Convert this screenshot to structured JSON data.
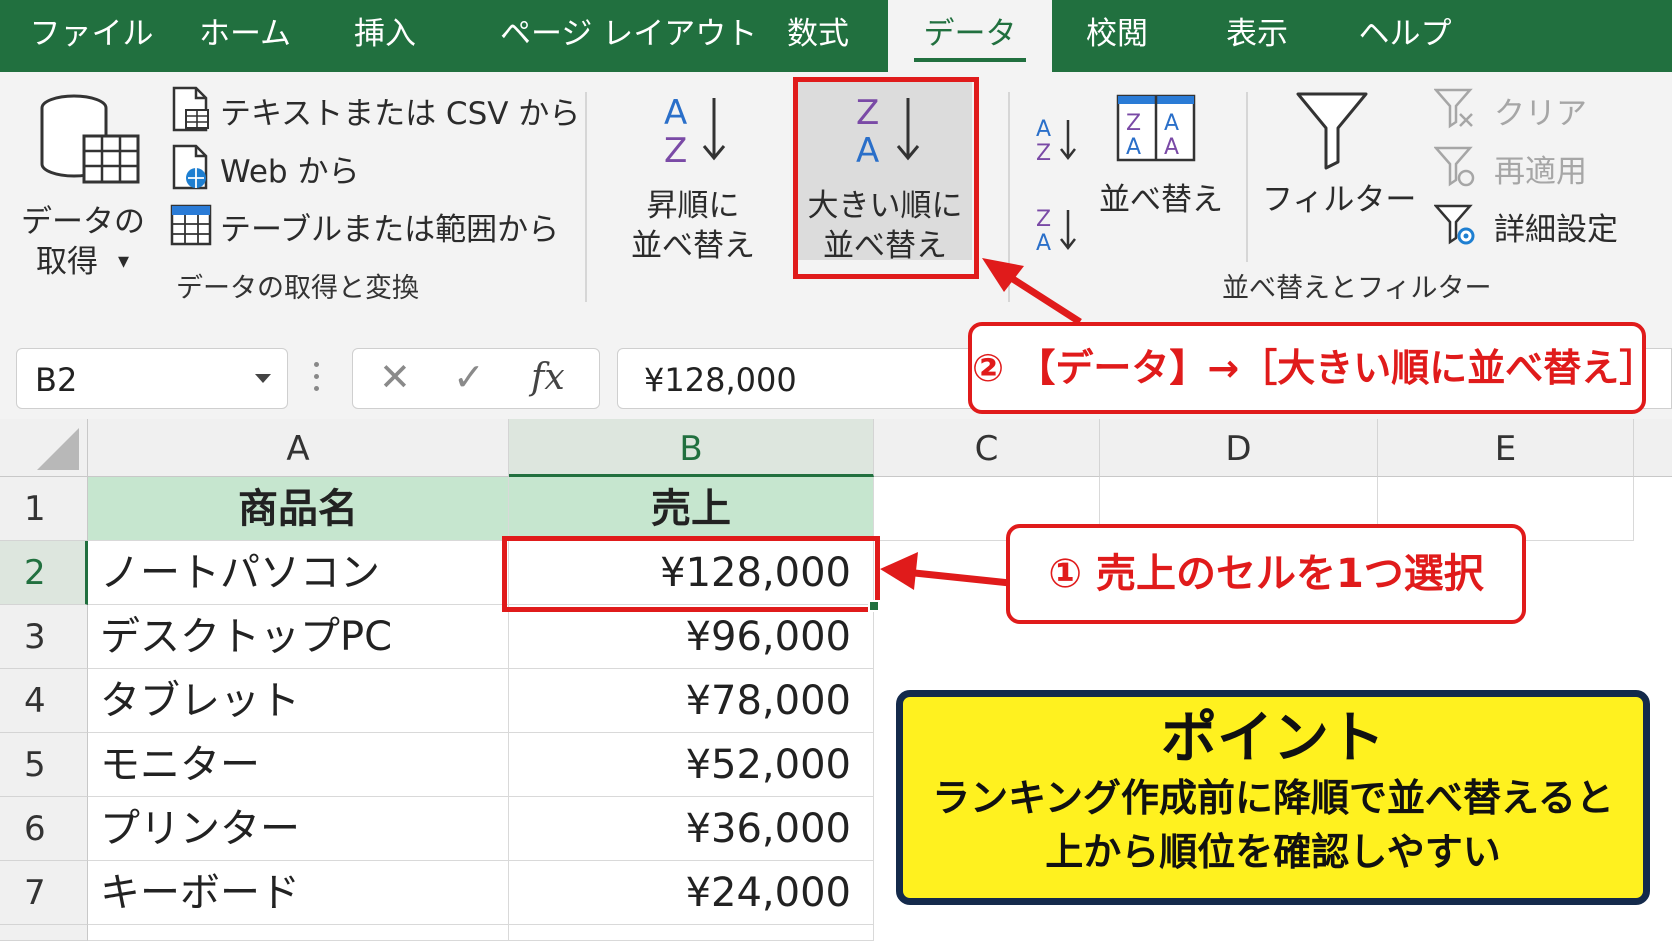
{
  "tabs": [
    {
      "label": "ファイル"
    },
    {
      "label": "ホーム"
    },
    {
      "label": "挿入"
    },
    {
      "label": "ページ レイアウト"
    },
    {
      "label": "数式"
    },
    {
      "label": "データ",
      "active": true
    },
    {
      "label": "校閲"
    },
    {
      "label": "表示"
    },
    {
      "label": "ヘルプ"
    }
  ],
  "ribbon": {
    "get_transform": {
      "get_data_line1": "データの",
      "get_data_line2": "取得",
      "dropdown_arrow": "▾",
      "text_csv": "テキストまたは CSV から",
      "web": "Web から",
      "table_range": "テーブルまたは範囲から",
      "group_label": "データの取得と変換"
    },
    "sort_filter": {
      "asc_line1": "昇順に",
      "asc_line2": "並べ替え",
      "desc_line1": "大きい順に",
      "desc_line2": "並べ替え",
      "sort": "並べ替え",
      "filter": "フィルター",
      "clear": "クリア",
      "reapply": "再適用",
      "advanced": "詳細設定",
      "group_label": "並べ替えとフィルター"
    }
  },
  "formula_bar": {
    "name_box": "B2",
    "cancel": "✕",
    "enter": "✓",
    "fx": "fx",
    "value": "¥128,000"
  },
  "sheet": {
    "columns": [
      "A",
      "B",
      "C",
      "D",
      "E"
    ],
    "rows": [
      "1",
      "2",
      "3",
      "4",
      "5",
      "6",
      "7"
    ],
    "header": {
      "a": "商品名",
      "b": "売上"
    },
    "data": [
      {
        "name": "ノートパソコン",
        "sales": "¥128,000"
      },
      {
        "name": "デスクトップPC",
        "sales": "¥96,000"
      },
      {
        "name": "タブレット",
        "sales": "¥78,000"
      },
      {
        "name": "モニター",
        "sales": "¥52,000"
      },
      {
        "name": "プリンター",
        "sales": "¥36,000"
      },
      {
        "name": "キーボード",
        "sales": "¥24,000"
      }
    ]
  },
  "annotations": {
    "step2": "② 【データ】→［大きい順に並べ替え］",
    "step1": "① 売上のセルを1つ選択",
    "point_title": "ポイント",
    "point_line1": "ランキング作成前に降順で並べ替えると",
    "point_line2": "上から順位を確認しやすい"
  },
  "colors": {
    "excel_green": "#21703f",
    "header_fill": "#c6e6cf",
    "callout_red": "#e01b1b",
    "point_yellow": "#fff11f",
    "point_border": "#142a4b"
  }
}
